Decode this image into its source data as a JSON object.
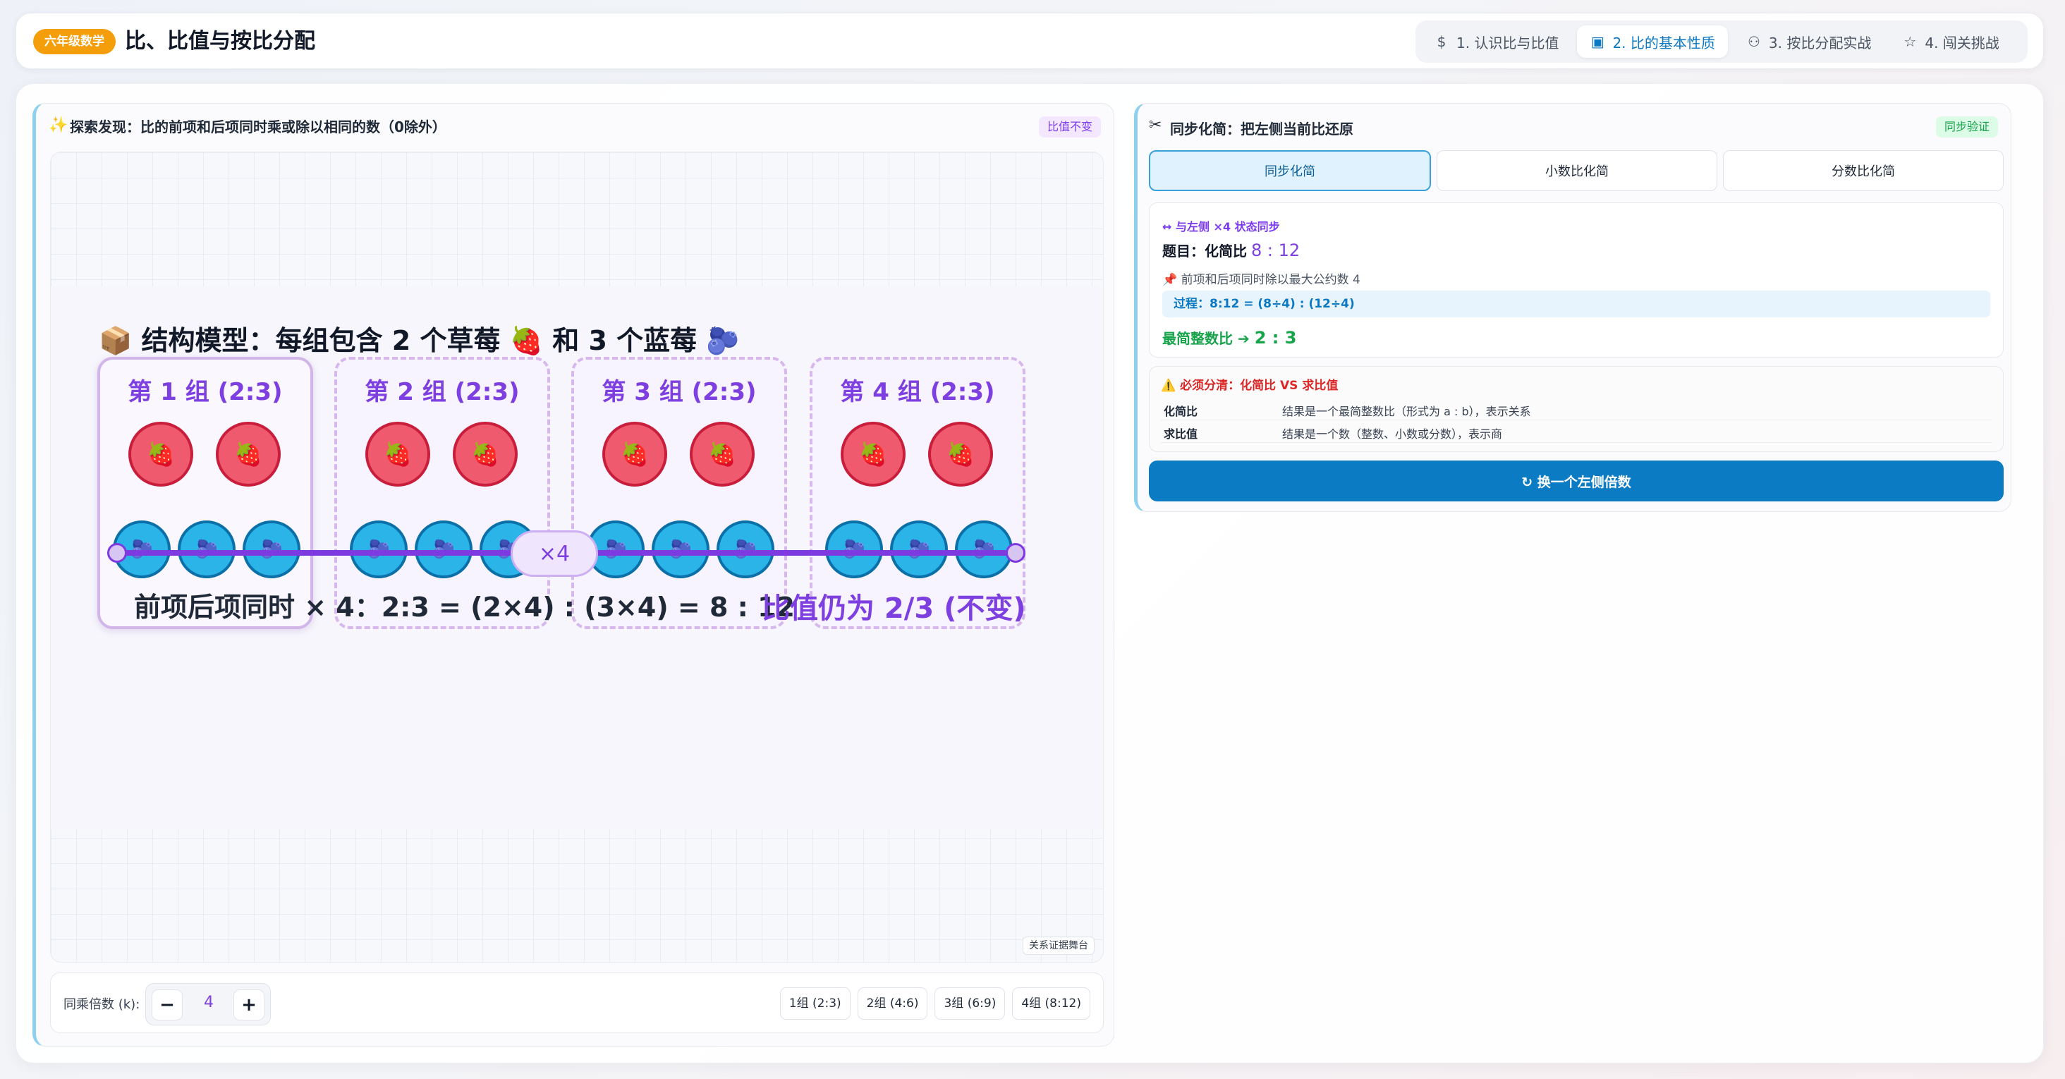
{
  "header": {
    "grade_badge": "六年级数学",
    "title": "比、比值与按比分配",
    "tabs": [
      {
        "icon": "dollar-icon",
        "glyph": "$",
        "label": "1. 认识比与比值",
        "active": false
      },
      {
        "icon": "layout-icon",
        "glyph": "▣",
        "label": "2. 比的基本性质",
        "active": true
      },
      {
        "icon": "users-icon",
        "glyph": "⚇",
        "label": "3. 按比分配实战",
        "active": false
      },
      {
        "icon": "star-icon",
        "glyph": "☆",
        "label": "4. 闯关挑战",
        "active": false
      }
    ]
  },
  "left": {
    "icon": "✨",
    "title": "探索发现：比的前项和后项同时乘或除以相同的数（0除外）",
    "tag": "比值不变",
    "model_title": "📦 结构模型：每组包含 2 个草莓 🍓 和 3 个蓝莓 🫐",
    "groups": [
      {
        "label": "第 1 组 (2:3)"
      },
      {
        "label": "第 2 组 (2:3)"
      },
      {
        "label": "第 3 组 (2:3)"
      },
      {
        "label": "第 4 组 (2:3)"
      }
    ],
    "strawberry": "🍓",
    "blueberry": "🫐",
    "multiplier_pill": "×4",
    "formula": "前项后项同时 × 4：2:3 = (2×4) : (3×4) = 8 : 12",
    "formula_note": "比值仍为 2/3 (不变)",
    "stage_tag": "关系证据舞台",
    "control_label": "同乘倍数 (k):",
    "stepper": {
      "minus": "−",
      "value": "4",
      "plus": "+"
    },
    "presets": [
      "1组 (2:3)",
      "2组 (4:6)",
      "3组 (6:9)",
      "4组 (8:12)"
    ]
  },
  "right": {
    "icon": "✂",
    "title": "同步化简：把左侧当前比还原",
    "tag": "同步验证",
    "tabs": [
      {
        "label": "同步化简",
        "active": true
      },
      {
        "label": "小数比化简",
        "active": false
      },
      {
        "label": "分数比化简",
        "active": false
      }
    ],
    "sync_note": "↔ 与左侧 ×4 状态同步",
    "question_label": "题目：化简比",
    "question_ratio": "8 : 12",
    "hint": "📌 前项和后项同时除以最大公约数 4",
    "process": "过程：8:12 = (8÷4) : (12÷4)",
    "result_label": "最简整数比 ➔",
    "result_value": "2 : 3",
    "warn_title": "⚠️ 必须分清：化简比 VS 求比值",
    "warn_rows": [
      {
        "k": "化简比",
        "v": "结果是一个最简整数比（形式为 a : b），表示关系"
      },
      {
        "k": "求比值",
        "v": "结果是一个数（整数、小数或分数），表示商"
      }
    ],
    "button": "↻ 换一个左侧倍数"
  }
}
